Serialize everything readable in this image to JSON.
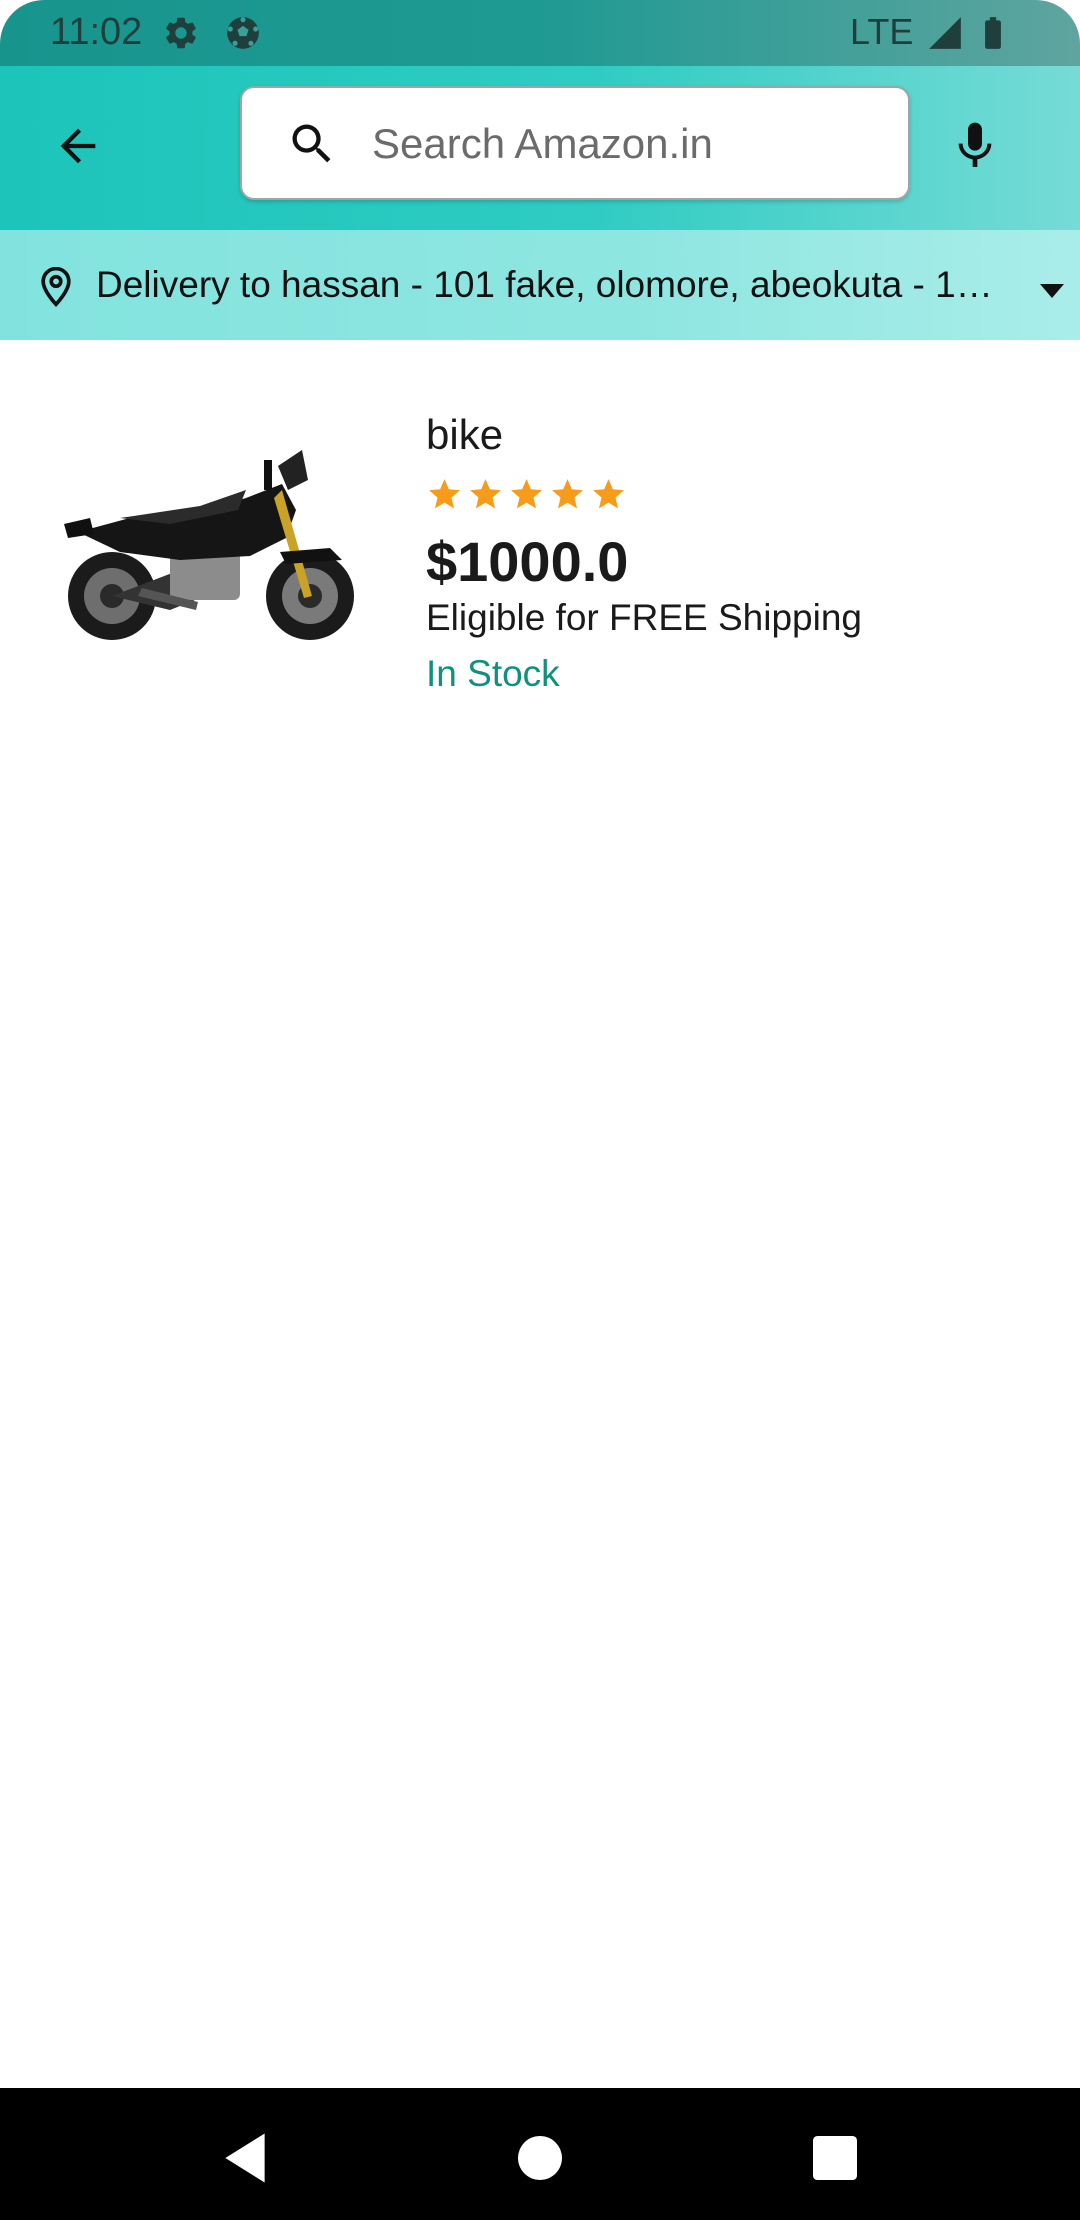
{
  "status_bar": {
    "time": "11:02",
    "network": "LTE",
    "icons": [
      "settings-gear-icon",
      "soccer-ball-icon",
      "signal-icon",
      "battery-icon"
    ]
  },
  "header": {
    "back_icon": "arrow-left-icon",
    "search": {
      "value": "",
      "placeholder": "Search Amazon.in"
    },
    "mic_icon": "microphone-icon"
  },
  "delivery": {
    "text": "Delivery to hassan - 101 fake, olomore, abeokuta - 1…",
    "icon": "location-pin-icon",
    "dropdown_icon": "caret-down-icon"
  },
  "products": [
    {
      "title": "bike",
      "rating": 5,
      "rating_max": 5,
      "price": "$1000.0",
      "shipping": "Eligible for FREE Shipping",
      "stock": "In Stock",
      "image": "motorcycle-image"
    }
  ],
  "colors": {
    "app_bar": "#1cc4b9",
    "delivery_bar": "#8fe6e1",
    "star": "#f79b1b",
    "in_stock": "#10917f"
  },
  "nav_bar": {
    "icons": [
      "back-triangle-icon",
      "home-circle-icon",
      "recents-square-icon"
    ]
  }
}
